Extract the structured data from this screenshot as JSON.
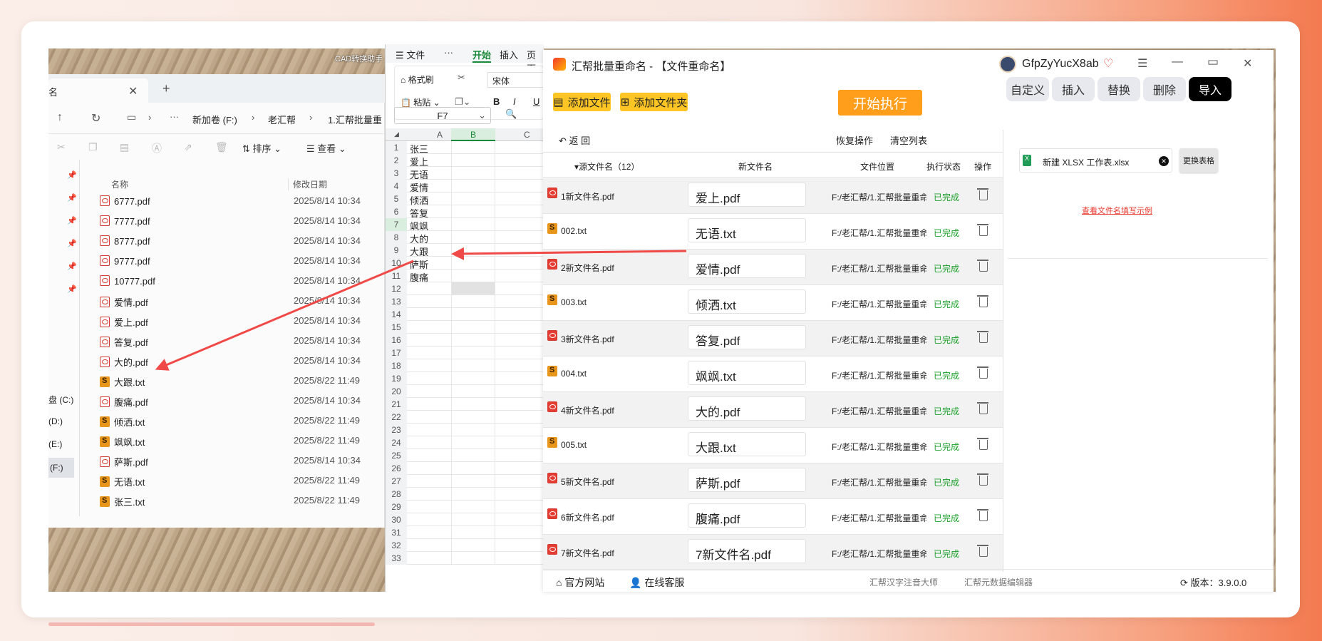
{
  "explorer": {
    "tab_label": "名",
    "breadcrumb": [
      "新加卷 (F:)",
      "老汇帮",
      "1.汇帮批量重"
    ],
    "sort_label": "排序",
    "view_label": "查看",
    "col_name": "名称",
    "col_date": "修改日期",
    "drives": [
      "盘 (C:)",
      "(D:)",
      "(E:)",
      "(F:)"
    ],
    "top_label": "CAD转换助手",
    "files": [
      {
        "name": "6777.pdf",
        "date": "2025/8/14 10:34",
        "type": "pdf"
      },
      {
        "name": "7777.pdf",
        "date": "2025/8/14 10:34",
        "type": "pdf"
      },
      {
        "name": "8777.pdf",
        "date": "2025/8/14 10:34",
        "type": "pdf"
      },
      {
        "name": "9777.pdf",
        "date": "2025/8/14 10:34",
        "type": "pdf"
      },
      {
        "name": "10777.pdf",
        "date": "2025/8/14 10:34",
        "type": "pdf"
      },
      {
        "name": "爱情.pdf",
        "date": "2025/8/14 10:34",
        "type": "pdf"
      },
      {
        "name": "爱上.pdf",
        "date": "2025/8/14 10:34",
        "type": "pdf"
      },
      {
        "name": "答复.pdf",
        "date": "2025/8/14 10:34",
        "type": "pdf"
      },
      {
        "name": "大的.pdf",
        "date": "2025/8/14 10:34",
        "type": "pdf"
      },
      {
        "name": "大跟.txt",
        "date": "2025/8/22 11:49",
        "type": "txt"
      },
      {
        "name": "腹痛.pdf",
        "date": "2025/8/14 10:34",
        "type": "pdf"
      },
      {
        "name": "倾洒.txt",
        "date": "2025/8/22 11:49",
        "type": "txt"
      },
      {
        "name": "飒飒.txt",
        "date": "2025/8/22 11:49",
        "type": "txt"
      },
      {
        "name": "萨斯.pdf",
        "date": "2025/8/14 10:34",
        "type": "pdf"
      },
      {
        "name": "无语.txt",
        "date": "2025/8/22 11:49",
        "type": "txt"
      },
      {
        "name": "张三.txt",
        "date": "2025/8/22 11:49",
        "type": "txt"
      }
    ]
  },
  "wps": {
    "menu": [
      "文件",
      "···",
      "开始",
      "插入",
      "页面"
    ],
    "format_brush": "格式刷",
    "paste": "粘贴",
    "font": "宋体",
    "cell_ref": "F7",
    "col_headers": [
      "A",
      "B",
      "C"
    ],
    "cells": [
      "张三",
      "爱上",
      "无语",
      "爱情",
      "倾洒",
      "答复",
      "飒飒",
      "大的",
      "大跟",
      "萨斯",
      "腹痛"
    ],
    "row_numbers": [
      "1",
      "2",
      "3",
      "4",
      "5",
      "6",
      "7",
      "8",
      "9",
      "10",
      "11",
      "12",
      "13",
      "14",
      "15",
      "16",
      "17",
      "18",
      "19",
      "20",
      "21",
      "22",
      "23",
      "24",
      "25",
      "26",
      "27",
      "28",
      "29",
      "30",
      "31",
      "32",
      "33"
    ]
  },
  "app": {
    "title": "汇帮批量重命名 - 【文件重命名】",
    "username": "GfpZyYucX8ab",
    "add_file": "添加文件",
    "add_folder": "添加文件夹",
    "start": "开始执行",
    "back": "返  回",
    "restore": "恢复操作",
    "clear": "清空列表",
    "col_src": "源文件名（12）",
    "col_new": "新文件名",
    "col_loc": "文件位置",
    "col_status": "执行状态",
    "col_op": "操作",
    "rows": [
      {
        "src": "1新文件名.pdf",
        "new": "爱上.pdf",
        "loc": "F:/老汇帮/1.汇帮批量重命",
        "status": "已完成",
        "type": "pdf"
      },
      {
        "src": "002.txt",
        "new": "无语.txt",
        "loc": "F:/老汇帮/1.汇帮批量重命",
        "status": "已完成",
        "type": "txt"
      },
      {
        "src": "2新文件名.pdf",
        "new": "爱情.pdf",
        "loc": "F:/老汇帮/1.汇帮批量重命",
        "status": "已完成",
        "type": "pdf"
      },
      {
        "src": "003.txt",
        "new": "倾洒.txt",
        "loc": "F:/老汇帮/1.汇帮批量重命",
        "status": "已完成",
        "type": "txt"
      },
      {
        "src": "3新文件名.pdf",
        "new": "答复.pdf",
        "loc": "F:/老汇帮/1.汇帮批量重命",
        "status": "已完成",
        "type": "pdf"
      },
      {
        "src": "004.txt",
        "new": "飒飒.txt",
        "loc": "F:/老汇帮/1.汇帮批量重命",
        "status": "已完成",
        "type": "txt"
      },
      {
        "src": "4新文件名.pdf",
        "new": "大的.pdf",
        "loc": "F:/老汇帮/1.汇帮批量重命",
        "status": "已完成",
        "type": "pdf"
      },
      {
        "src": "005.txt",
        "new": "大跟.txt",
        "loc": "F:/老汇帮/1.汇帮批量重命",
        "status": "已完成",
        "type": "txt"
      },
      {
        "src": "5新文件名.pdf",
        "new": "萨斯.pdf",
        "loc": "F:/老汇帮/1.汇帮批量重命",
        "status": "已完成",
        "type": "pdf"
      },
      {
        "src": "6新文件名.pdf",
        "new": "腹痛.pdf",
        "loc": "F:/老汇帮/1.汇帮批量重命",
        "status": "已完成",
        "type": "pdf"
      },
      {
        "src": "7新文件名.pdf",
        "new": "7新文件名.pdf",
        "loc": "F:/老汇帮/1.汇帮批量重命",
        "status": "已完成",
        "type": "pdf"
      }
    ],
    "tabs": [
      "自定义",
      "插入",
      "替换",
      "删除",
      "导入"
    ],
    "active_tab": "导入",
    "import_file": "新建 XLSX 工作表.xlsx",
    "replace_table": "更换表格",
    "example_link": "查看文件名填写示例",
    "footer_site": "官方网站",
    "footer_service": "在线客服",
    "footer_link1": "汇帮汉字注音大师",
    "footer_link2": "汇帮元数据编辑器",
    "version": "版本：3.9.0.0",
    "colors": {
      "accent_yellow": "#ffc525",
      "start_orange": "#ff9e1b",
      "done_green": "#1aa02a",
      "link_red": "#e8392d"
    }
  }
}
